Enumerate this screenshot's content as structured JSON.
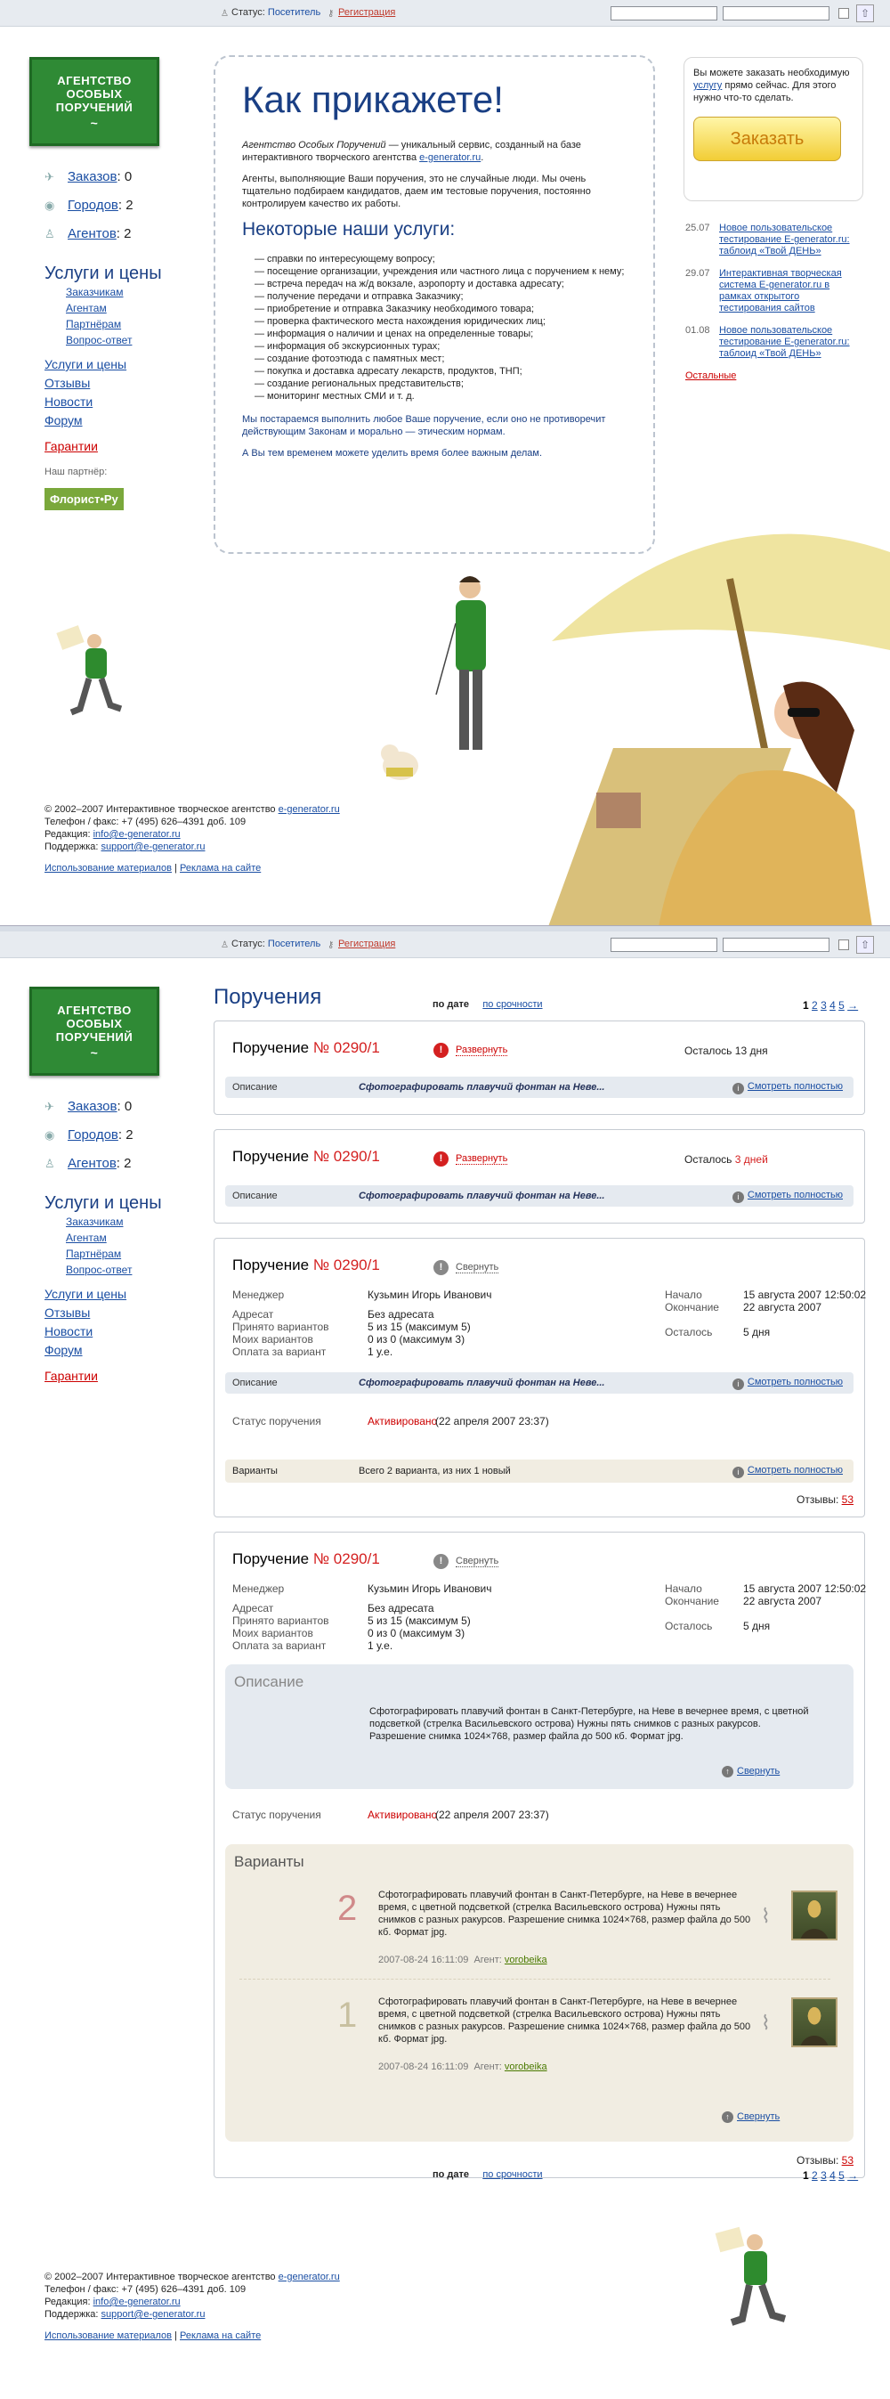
{
  "topbar": {
    "status_label": "Статус:",
    "status_value": "Посетитель",
    "register": "Регистрация"
  },
  "logo": {
    "line1": "АГЕНТСТВО",
    "line2": "ОСОБЫХ",
    "line3": "ПОРУЧЕНИЙ",
    "sig": "~"
  },
  "left": {
    "counters": [
      {
        "label": "Заказов",
        "value": "0"
      },
      {
        "label": "Городов",
        "value": "2"
      },
      {
        "label": "Агентов",
        "value": "2"
      }
    ],
    "services_title": "Услуги и цены",
    "services": [
      "Заказчикам",
      "Агентам",
      "Партнёрам",
      "Вопрос-ответ"
    ],
    "links": [
      "Услуги и цены",
      "Отзывы",
      "Новости",
      "Форум"
    ],
    "guarantee": "Гарантии",
    "partner_label": "Наш партнёр:",
    "partner": "Флорист•Ру"
  },
  "main": {
    "title": "Как прикажете!",
    "intro_italic": "Агентство Особых Поручений",
    "intro_rest": " — уникальный сервис, созданный на базе интерактивного творческого агентства ",
    "intro_link": "e-generator.ru",
    "p2": "Агенты, выполняющие Ваши поручения, это не случайные люди. Мы очень тщательно подбираем кандидатов, даем им тестовые поручения, постоянно контролируем качество их работы.",
    "services_heading": "Некоторые наши услуги:",
    "services": [
      "— справки по интересующему вопросу;",
      "— посещение организации, учреждения или частного лица с поручением к нему;",
      "— встреча передач на ж/д вокзале, аэропорту и доставка адресату;",
      "— получение передачи и отправка Заказчику;",
      "— приобретение и отправка Заказчику необходимого товара;",
      "— проверка фактического места нахождения юридических лиц;",
      "— информация о наличии и ценах на определенные товары;",
      "— информация об экскурсионных турах;",
      "— создание фотоэтюда с памятных мест;",
      "— покупка и доставка адресату лекарств, продуктов, ТНП;",
      "— создание региональных представительств;",
      "— мониторинг местных СМИ и т. д."
    ],
    "p3": "Мы постараемся выполнить любое Ваше поручение, если оно не противоречит действующим Законам и морально — этическим нормам.",
    "p4": "А Вы тем временем можете уделить время более важным делам."
  },
  "order": {
    "text1": "Вы можете заказать необходимую ",
    "link": "услугу",
    "text2": " прямо сейчас. Для этого нужно что-то сделать.",
    "button": "Заказать"
  },
  "news": [
    {
      "date": "25.07",
      "text": "Новое пользовательское тестирование E-generator.ru: таблоид «Твой ДЕНЬ»"
    },
    {
      "date": "29.07",
      "text": "Интерактивная творческая система E-generator.ru в рамках открытого тестирования сайтов"
    },
    {
      "date": "01.08",
      "text": "Новое пользовательское тестирование E-generator.ru: таблоид «Твой ДЕНЬ»"
    }
  ],
  "news_more": "Остальные",
  "footer": {
    "copy": "© 2002–2007 Интерактивное творческое агентство ",
    "copy_link": "e-generator.ru",
    "phone": "Телефон / факс: +7 (495) 626–4391 доб. 109",
    "edit_label": "Редакция: ",
    "edit_mail": "info@e-generator.ru",
    "support_label": "Поддержка: ",
    "support_mail": "support@e-generator.ru",
    "use": "Использование материалов",
    "sep": " | ",
    "ads": "Реклама на сайте"
  },
  "orders_page": {
    "title": "Поручения",
    "sort_date": "по дате",
    "sort_urgency": "по срочности",
    "pages": [
      "1",
      "2",
      "3",
      "4",
      "5",
      "→"
    ],
    "order_word": "Поручение",
    "order_num": "№ 0290/1",
    "expand": "Развернуть",
    "collapse": "Свернуть",
    "left1": "Осталось ",
    "left1_val": "13 дня",
    "left2": "Осталось ",
    "left2_val": "3 дней",
    "desc_label": "Описание",
    "desc_text": "Сфотографировать плавучий фонтан на Неве...",
    "view_full": "Смотреть полностью",
    "manager_label": "Менеджер",
    "manager": "Кузьмин Игорь Иванович",
    "addressee_label": "Адресат",
    "addressee": "Без адресата",
    "accepted_label": "Принято вариантов",
    "accepted": "5 из 15 (максимум 5)",
    "my_label": "Моих вариантов",
    "my": "0 из 0 (максимум 3)",
    "pay_label": "Оплата за вариант",
    "pay": "1 у.е.",
    "start_label": "Начало",
    "start": "15 августа 2007 12:50:02",
    "end_label": "Окончание",
    "end": "22 августа 2007",
    "remain_label": "Осталось",
    "remain": "5 дня",
    "status_label": "Статус поручения",
    "status": "Активировано",
    "status_date": " (22 апреля 2007 23:37)",
    "variants_label": "Варианты",
    "variants_text": "Всего 2 варианта, из них 1 новый",
    "reviews_label": "Отзывы: ",
    "reviews": "53",
    "desc_panel_title": "Описание",
    "desc_full": "Сфотографировать плавучий фонтан в Санкт-Петербурге, на Неве в вечернее время, с цветной подсветкой (стрелка Васильевского острова) Нужны пять снимков с разных ракурсов. Разрешение снимка 1024×768, размер файла до 500 кб. Формат jpg.",
    "collapse_link": "Свернуть",
    "variants_panel_title": "Варианты",
    "variants": [
      {
        "n": "2",
        "text": "Сфотографировать плавучий фонтан в Санкт-Петербурге, на Неве в вечернее время, с цветной подсветкой (стрелка Васильевского острова) Нужны пять снимков с разных ракурсов. Разрешение снимка 1024×768, размер файла до 500 кб. Формат jpg.",
        "date": "2007-08-24 16:11:09",
        "agent_label": "Агент: ",
        "agent": "vorobeika"
      },
      {
        "n": "1",
        "text": "Сфотографировать плавучий фонтан в Санкт-Петербурге, на Неве в вечернее время, с цветной подсветкой (стрелка Васильевского острова) Нужны пять снимков с разных ракурсов. Разрешение снимка 1024×768, размер файла до 500 кб. Формат jpg.",
        "date": "2007-08-24 16:11:09",
        "agent_label": "Агент: ",
        "agent": "vorobeika"
      }
    ]
  }
}
